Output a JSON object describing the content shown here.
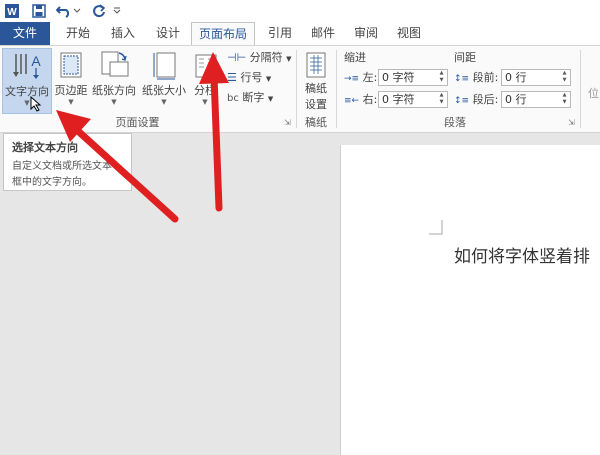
{
  "quick_access": {
    "icons": [
      "word-logo-icon",
      "save-icon",
      "undo-icon",
      "redo-icon",
      "customize-icon"
    ]
  },
  "tabs": [
    "文件",
    "开始",
    "插入",
    "设计",
    "页面布局",
    "引用",
    "邮件",
    "审阅",
    "视图"
  ],
  "active_tab": "页面布局",
  "ribbon": {
    "page_setup": {
      "text_direction": "文字方向",
      "margins": "页边距",
      "orientation": "纸张方向",
      "size": "纸张大小",
      "columns": "分栏",
      "breaks": "分隔符",
      "line_numbers": "行号",
      "hyphenation": "断字",
      "group_label": "页面设置"
    },
    "draft": {
      "button_top": "稿纸",
      "button_bottom": "设置",
      "group_label": "稿纸"
    },
    "paragraph": {
      "indent_title": "缩进",
      "spacing_title": "间距",
      "left_label": "左:",
      "right_label": "右:",
      "left_value": "0 字符",
      "right_value": "0 字符",
      "before_label": "段前:",
      "after_label": "段后:",
      "before_value": "0 行",
      "after_value": "0 行",
      "group_label": "段落"
    },
    "partial": "位"
  },
  "tooltip": {
    "title": "选择文本方向",
    "line1": "自定义文档或所选文本",
    "line2": "框中的文字方向。"
  },
  "document": {
    "text": "如何将字体竖着排"
  },
  "colors": {
    "file_tab": "#2b579a",
    "active_tab_text": "#2b579a",
    "arrow": "#e02020",
    "selected_button": "#c5d7ee"
  }
}
